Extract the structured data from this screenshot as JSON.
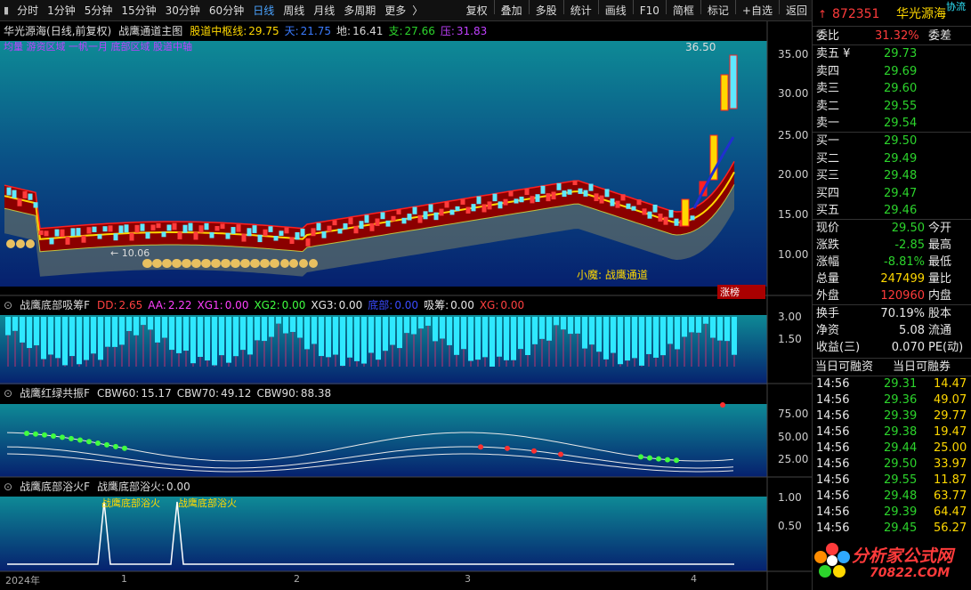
{
  "toolbar": {
    "periods": [
      "分时",
      "1分钟",
      "5分钟",
      "15分钟",
      "30分钟",
      "60分钟",
      "日线",
      "周线",
      "月线",
      "多周期",
      "更多"
    ],
    "active_period": "日线",
    "tools": [
      "复权",
      "叠加",
      "多股",
      "统计",
      "画线",
      "F10",
      "简框",
      "标记",
      "+自选",
      "返回"
    ],
    "tools_right_hint": "协流"
  },
  "main_chart": {
    "stock_label": "华光源海",
    "mode": "(日线,前复权)",
    "indicator_name": "战鹰通道主图",
    "params": [
      {
        "label": "股道中枢线:",
        "value": "29.75",
        "color": "#ffd800"
      },
      {
        "label": "天:",
        "value": "21.75",
        "color": "#3a7bff"
      },
      {
        "label": "地:",
        "value": "16.41",
        "color": "#d8d8d8"
      },
      {
        "label": "支:",
        "value": "27.66",
        "color": "#2cd42c"
      },
      {
        "label": "压:",
        "value": "31.83",
        "color": "#c040ff"
      }
    ],
    "sub_legend": "均量 游资区域 一帆一月 底部区域 股道中轴",
    "y_ticks": [
      "35.00",
      "30.00",
      "25.00",
      "20.00",
      "15.00",
      "10.00"
    ],
    "high_label": "36.50",
    "low_label": "10.06",
    "annotation": "小魔:  战鹰通道",
    "badge": "涨榜"
  },
  "panel_xichou": {
    "name": "战鹰底部吸筹F",
    "params": [
      {
        "label": "DD:",
        "value": "2.65",
        "color": "#ff4040"
      },
      {
        "label": "AA:",
        "value": "2.22",
        "color": "#ff40ff"
      },
      {
        "label": "XG1:",
        "value": "0.00",
        "color": "#ff40ff"
      },
      {
        "label": "XG2:",
        "value": "0.00",
        "color": "#40ff40"
      },
      {
        "label": "XG3:",
        "value": "0.00",
        "color": "#e8e8e8"
      },
      {
        "label": "底部:",
        "value": "0.00",
        "color": "#3a4bff"
      },
      {
        "label": "吸筹:",
        "value": "0.00",
        "color": "#e8e8e8"
      },
      {
        "label": "XG:",
        "value": "0.00",
        "color": "#ff4040"
      }
    ],
    "y_ticks": [
      "3.00",
      "1.50"
    ]
  },
  "panel_gongzhen": {
    "name": "战鹰红绿共振F",
    "params": [
      {
        "label": "CBW60:",
        "value": "15.17"
      },
      {
        "label": "CBW70:",
        "value": "49.12"
      },
      {
        "label": "CBW90:",
        "value": "88.38"
      }
    ],
    "y_ticks": [
      "75.00",
      "50.00",
      "25.00"
    ]
  },
  "panel_yuhuo": {
    "name": "战鹰底部浴火F",
    "params": [
      {
        "label": "战鹰底部浴火:",
        "value": "0.00"
      }
    ],
    "markers": [
      "战鹰底部浴火",
      "战鹰底部浴火"
    ],
    "y_ticks": [
      "1.00",
      "0.50"
    ]
  },
  "time_axis": {
    "labels": [
      "2024年",
      "1",
      "2",
      "3",
      "4"
    ]
  },
  "quote": {
    "code": "872351",
    "name": "华光源海",
    "weibi": {
      "label": "委比",
      "value": "31.32%",
      "right": "委差"
    },
    "asks": [
      {
        "label": "卖五 ¥",
        "price": "29.73"
      },
      {
        "label": "卖四",
        "price": "29.69"
      },
      {
        "label": "卖三",
        "price": "29.60"
      },
      {
        "label": "卖二",
        "price": "29.55"
      },
      {
        "label": "卖一",
        "price": "29.54"
      }
    ],
    "bids": [
      {
        "label": "买一",
        "price": "29.50"
      },
      {
        "label": "买二",
        "price": "29.49"
      },
      {
        "label": "买三",
        "price": "29.48"
      },
      {
        "label": "买四",
        "price": "29.47"
      },
      {
        "label": "买五",
        "price": "29.46"
      }
    ],
    "stats": [
      {
        "label": "现价",
        "value": "29.50",
        "color": "#2cd42c",
        "right": "今开"
      },
      {
        "label": "涨跌",
        "value": "-2.85",
        "color": "#2cd42c",
        "right": "最高"
      },
      {
        "label": "涨幅",
        "value": "-8.81%",
        "color": "#2cd42c",
        "right": "最低"
      },
      {
        "label": "总量",
        "value": "247499",
        "color": "#ffd800",
        "right": "量比"
      },
      {
        "label": "外盘",
        "value": "120960",
        "color": "#ff3b3b",
        "right": "内盘"
      }
    ],
    "stats2": [
      {
        "label": "换手",
        "value": "70.19%",
        "right": "股本"
      },
      {
        "label": "净资",
        "value": "5.08",
        "right": "流通"
      },
      {
        "label": "收益(三)",
        "value": "0.070",
        "right": "PE(动)"
      }
    ],
    "margin_tabs": [
      "当日可融资",
      "当日可融券"
    ],
    "ticks": [
      {
        "time": "14:56",
        "price": "29.31",
        "vol": "14.47"
      },
      {
        "time": "14:56",
        "price": "29.36",
        "vol": "49.07"
      },
      {
        "time": "14:56",
        "price": "29.39",
        "vol": "29.77"
      },
      {
        "time": "14:56",
        "price": "29.38",
        "vol": "19.47"
      },
      {
        "time": "14:56",
        "price": "29.44",
        "vol": "25.00"
      },
      {
        "time": "14:56",
        "price": "29.50",
        "vol": "33.97"
      },
      {
        "time": "14:56",
        "price": "29.55",
        "vol": "11.87"
      },
      {
        "time": "14:56",
        "price": "29.48",
        "vol": "63.77"
      },
      {
        "time": "14:56",
        "price": "29.39",
        "vol": "64.47"
      },
      {
        "time": "14:56",
        "price": "29.45",
        "vol": "56.27"
      }
    ],
    "logo_text": "分析家公式网",
    "logo_url": "70822.COM"
  },
  "colors": {
    "up": "#ff3b3b",
    "down": "#2cd42c",
    "channel_red": "#8b0000",
    "bg_teal": "#0e8a96",
    "bg_navy": "#06206e"
  }
}
